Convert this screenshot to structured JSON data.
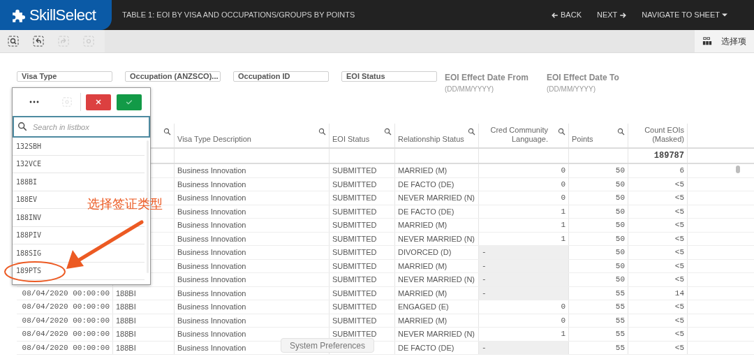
{
  "header": {
    "app_title": "SkillSelect",
    "sheet_title": "TABLE 1: EOI BY VISA AND OCCUPATIONS/GROUPS BY POINTS",
    "nav": [
      {
        "label": "BACK",
        "kind": "back"
      },
      {
        "label": "NEXT",
        "kind": "next"
      },
      {
        "label": "NAVIGATE TO SHEET",
        "kind": "menu"
      }
    ]
  },
  "toolbar": {
    "tools": [
      {
        "kind": "search",
        "disabled": false
      },
      {
        "kind": "back",
        "disabled": false
      },
      {
        "kind": "forward",
        "disabled": true
      },
      {
        "kind": "clear",
        "disabled": true
      }
    ],
    "selections_label": "选择项"
  },
  "filters": [
    {
      "kind": "field",
      "label": "Visa Type"
    },
    {
      "kind": "field",
      "label": "Occupation (ANZSCO)..."
    },
    {
      "kind": "field",
      "label": "Occupation ID"
    },
    {
      "kind": "field",
      "label": "EOI Status"
    },
    {
      "kind": "date",
      "label": "EOI Effect Date From",
      "hint": "(DD/MM/YYYY)"
    },
    {
      "kind": "date",
      "label": "EOI Effect Date To",
      "hint": "(DD/MM/YYYY)"
    }
  ],
  "listbox": {
    "clear_disabled": true,
    "placeholder": "Search in listbox",
    "items": [
      {
        "label": "132SBH",
        "selected": false
      },
      {
        "label": "132VCE",
        "selected": false
      },
      {
        "label": "188BI",
        "selected": false
      },
      {
        "label": "188EV",
        "selected": false
      },
      {
        "label": "188INV",
        "selected": false
      },
      {
        "label": "188PIV",
        "selected": false
      },
      {
        "label": "188SIG",
        "selected": false
      },
      {
        "label": "189PTS",
        "selected": false
      }
    ]
  },
  "table": {
    "columns": [
      {
        "searchable": true
      },
      {
        "label": "Visa Type Description",
        "searchable": true
      },
      {
        "label": "EOI Status",
        "searchable": true
      },
      {
        "label": "Relationship Status",
        "searchable": true
      },
      {
        "label": "Cred Community Language.",
        "searchable": true
      },
      {
        "label": "Points",
        "searchable": true
      },
      {
        "label": "Count EOIs (Masked)",
        "searchable": false
      }
    ],
    "total": "189787",
    "rows": [
      {
        "description": "Business Innovation",
        "eoi_status": "SUBMITTED",
        "relationship": "MARRIED (M)",
        "cred": "0",
        "cred_missing": false,
        "points": "50",
        "count": "6"
      },
      {
        "description": "Business Innovation",
        "eoi_status": "SUBMITTED",
        "relationship": "DE FACTO (DE)",
        "cred": "0",
        "cred_missing": false,
        "points": "50",
        "count": "<5"
      },
      {
        "description": "Business Innovation",
        "eoi_status": "SUBMITTED",
        "relationship": "NEVER MARRIED (N)",
        "cred": "0",
        "cred_missing": false,
        "points": "50",
        "count": "<5"
      },
      {
        "description": "Business Innovation",
        "eoi_status": "SUBMITTED",
        "relationship": "DE FACTO (DE)",
        "cred": "1",
        "cred_missing": false,
        "points": "50",
        "count": "<5"
      },
      {
        "description": "Business Innovation",
        "eoi_status": "SUBMITTED",
        "relationship": "MARRIED (M)",
        "cred": "1",
        "cred_missing": false,
        "points": "50",
        "count": "<5"
      },
      {
        "description": "Business Innovation",
        "eoi_status": "SUBMITTED",
        "relationship": "NEVER MARRIED (N)",
        "cred": "1",
        "cred_missing": false,
        "points": "50",
        "count": "<5"
      },
      {
        "description": "Business Innovation",
        "eoi_status": "SUBMITTED",
        "relationship": "DIVORCED (D)",
        "cred": "-",
        "cred_missing": true,
        "points": "50",
        "count": "<5"
      },
      {
        "description": "Business Innovation",
        "eoi_status": "SUBMITTED",
        "relationship": "MARRIED (M)",
        "cred": "-",
        "cred_missing": true,
        "points": "50",
        "count": "<5"
      },
      {
        "description": "Business Innovation",
        "eoi_status": "SUBMITTED",
        "relationship": "NEVER MARRIED (N)",
        "cred": "-",
        "cred_missing": true,
        "points": "50",
        "count": "<5"
      },
      {
        "date": "08/04/2020 00:00:00",
        "visa_type": "188BI",
        "description": "Business Innovation",
        "eoi_status": "SUBMITTED",
        "relationship": "MARRIED (M)",
        "cred": "-",
        "cred_missing": true,
        "points": "55",
        "count": "14"
      },
      {
        "date": "08/04/2020 00:00:00",
        "visa_type": "188BI",
        "description": "Business Innovation",
        "eoi_status": "SUBMITTED",
        "relationship": "ENGAGED (E)",
        "cred": "0",
        "cred_missing": false,
        "points": "55",
        "count": "<5"
      },
      {
        "date": "08/04/2020 00:00:00",
        "visa_type": "188BI",
        "description": "Business Innovation",
        "eoi_status": "SUBMITTED",
        "relationship": "MARRIED (M)",
        "cred": "0",
        "cred_missing": false,
        "points": "55",
        "count": "<5"
      },
      {
        "date": "08/04/2020 00:00:00",
        "visa_type": "188BI",
        "description": "Business Innovation",
        "eoi_status": "SUBMITTED",
        "relationship": "NEVER MARRIED (N)",
        "cred": "1",
        "cred_missing": false,
        "points": "55",
        "count": "<5"
      },
      {
        "date": "08/04/2020 00:00:00",
        "visa_type": "188BI",
        "description": "Business Innovation",
        "relationship": "DE FACTO (DE)",
        "cred": "-",
        "cred_missing": true,
        "points": "55",
        "count": "<5"
      }
    ]
  },
  "annotation": {
    "text": "选择签证类型"
  },
  "tooltip": {
    "text": "System Preferences"
  }
}
